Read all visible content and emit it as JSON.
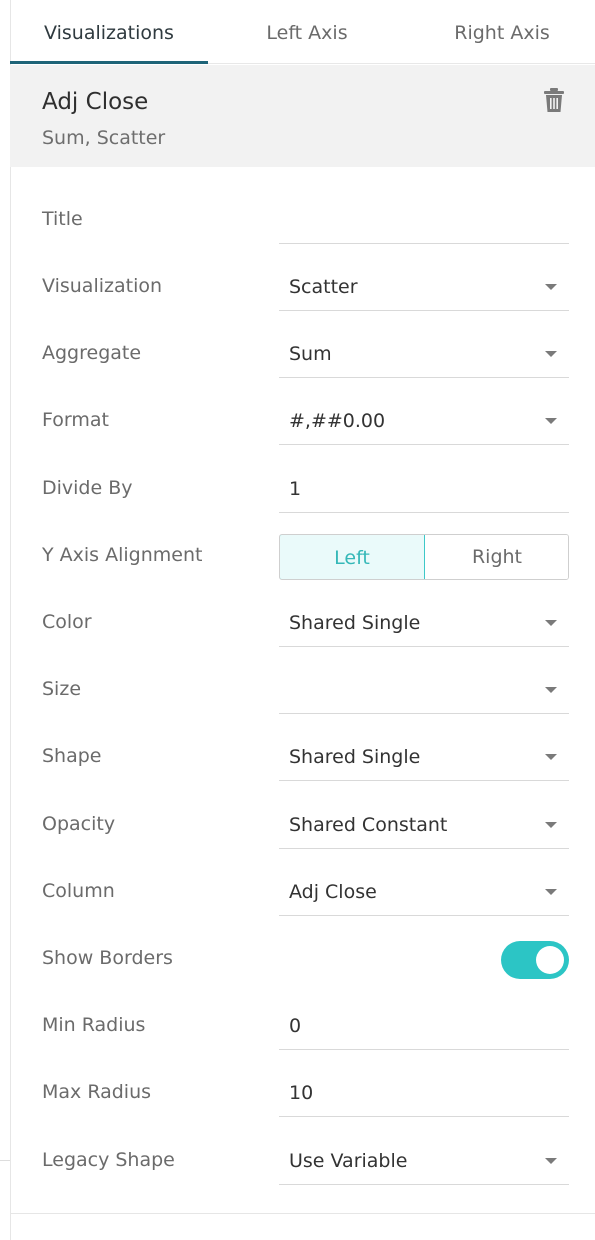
{
  "tabs": [
    {
      "label": "Visualizations",
      "active": true
    },
    {
      "label": "Left Axis",
      "active": false
    },
    {
      "label": "Right Axis",
      "active": false
    }
  ],
  "header": {
    "title": "Adj Close",
    "subtitle": "Sum, Scatter",
    "delete_icon": "trash-icon"
  },
  "form": {
    "title": {
      "label": "Title",
      "value": ""
    },
    "visualization": {
      "label": "Visualization",
      "value": "Scatter"
    },
    "aggregate": {
      "label": "Aggregate",
      "value": "Sum"
    },
    "format": {
      "label": "Format",
      "value": "#,##0.00"
    },
    "divide_by": {
      "label": "Divide By",
      "value": "1"
    },
    "y_axis_alignment": {
      "label": "Y Axis Alignment",
      "options": [
        "Left",
        "Right"
      ],
      "selected": "Left"
    },
    "color": {
      "label": "Color",
      "value": "Shared Single"
    },
    "size": {
      "label": "Size",
      "value": ""
    },
    "shape": {
      "label": "Shape",
      "value": "Shared Single"
    },
    "opacity": {
      "label": "Opacity",
      "value": "Shared Constant"
    },
    "column": {
      "label": "Column",
      "value": "Adj Close"
    },
    "show_borders": {
      "label": "Show Borders",
      "on": true
    },
    "min_radius": {
      "label": "Min Radius",
      "value": "0"
    },
    "max_radius": {
      "label": "Max Radius",
      "value": "10"
    },
    "legacy_shape": {
      "label": "Legacy Shape",
      "value": "Use Variable"
    }
  },
  "colors": {
    "accent": "#2cc5c5",
    "tab_underline": "#1e6478",
    "header_bg": "#f2f2f2"
  }
}
